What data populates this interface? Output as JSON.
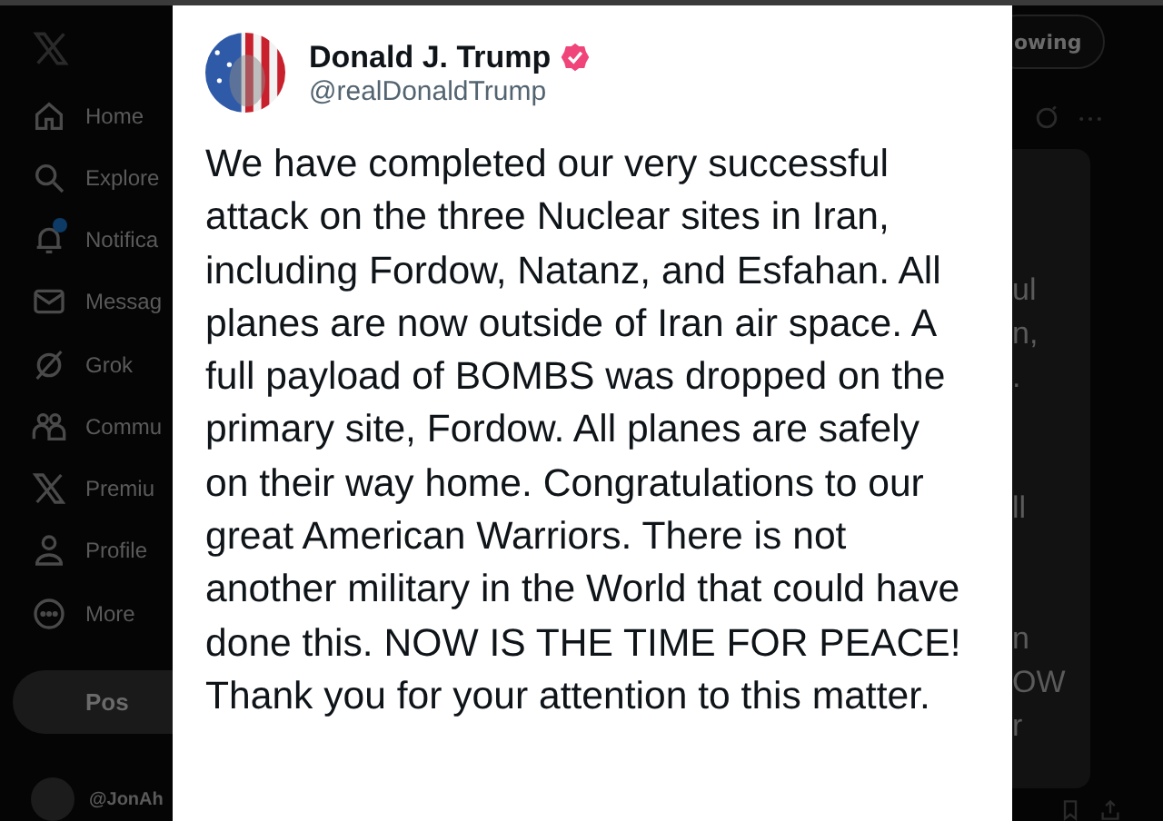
{
  "sidebar": {
    "items": [
      {
        "label": "Home",
        "kind": "home"
      },
      {
        "label": "Explore",
        "kind": "search"
      },
      {
        "label": "Notifica",
        "kind": "bell",
        "badge": true
      },
      {
        "label": "Messag",
        "kind": "mail"
      },
      {
        "label": "Grok",
        "kind": "slash"
      },
      {
        "label": "Commu",
        "kind": "people"
      },
      {
        "label": "Premiu",
        "kind": "x"
      },
      {
        "label": "Profile",
        "kind": "person"
      },
      {
        "label": "More",
        "kind": "more"
      }
    ],
    "post_button": "Pos",
    "account": "@JonAh"
  },
  "feed_tab": "owing",
  "background_fragments": [
    "ul",
    "n,",
    ".",
    "ll",
    "n",
    "OW",
    "r"
  ],
  "post": {
    "name": "Donald J. Trump",
    "verified": true,
    "handle": "@realDonaldTrump",
    "text": "We have completed our very successful attack on the three Nuclear sites in Iran, including Fordow, Natanz, and Esfahan. All planes are now outside of Iran air space. A full payload of BOMBS was dropped on the primary site, Fordow. All planes are safely on their way home. Congratulations to our great American Warriors. There is not another military in the World that could have done this. NOW IS THE TIME FOR PEACE! Thank you for your attention to this matter."
  }
}
